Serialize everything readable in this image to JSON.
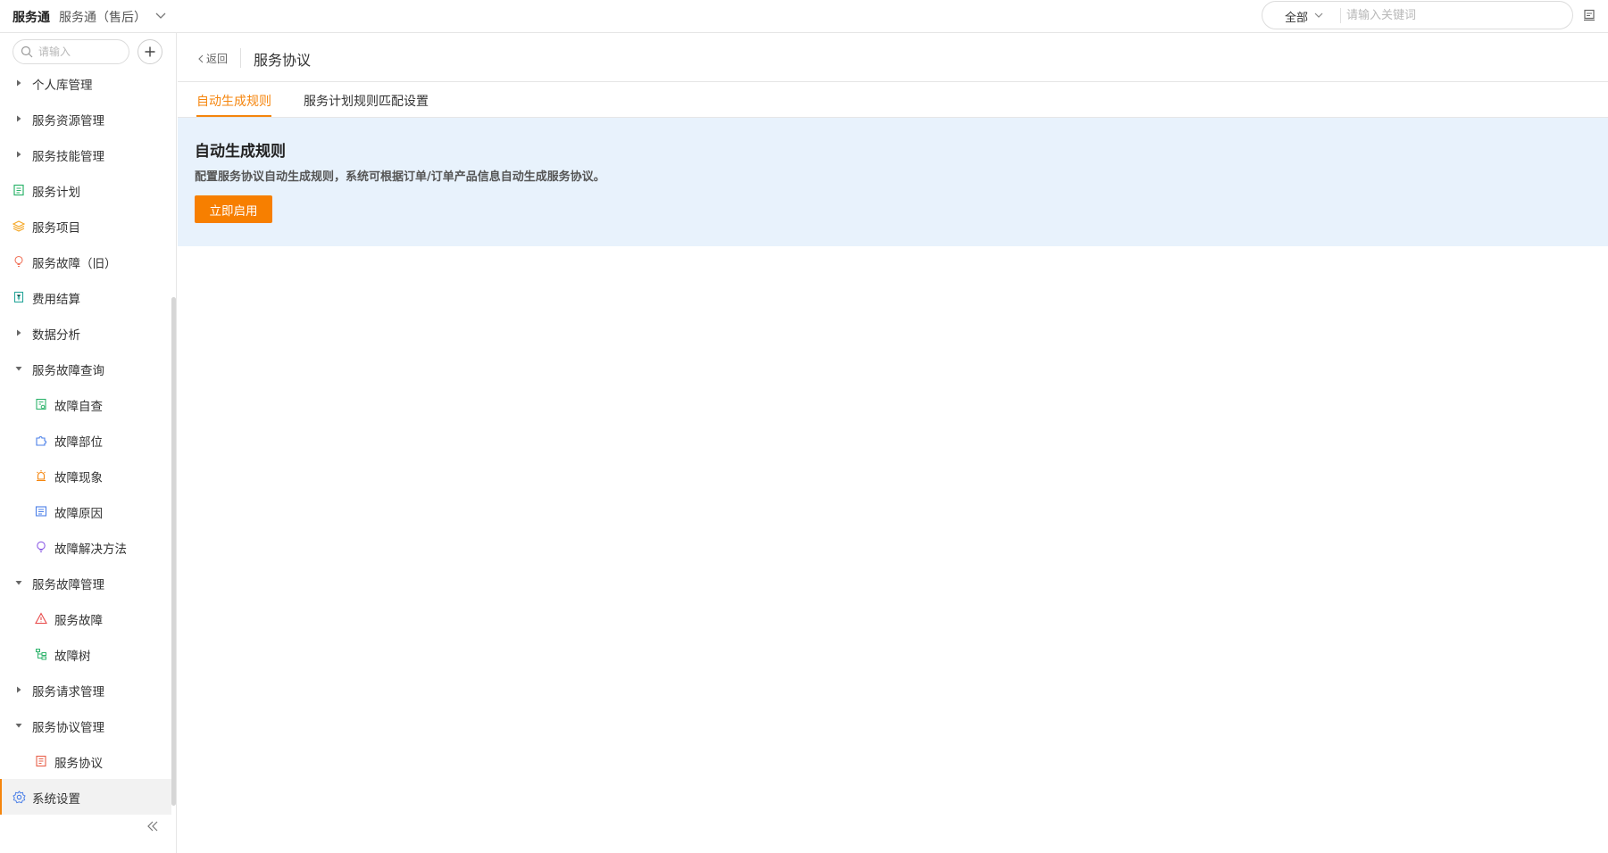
{
  "topbar": {
    "app_name": "服务通",
    "app_subtitle": "服务通（售后）",
    "search_scope": "全部",
    "search_placeholder": "请输入关键词"
  },
  "sidebar": {
    "search_placeholder": "请输入",
    "items": [
      {
        "label": "个人库管理",
        "icon": "caret-right-icon",
        "level": 0
      },
      {
        "label": "服务资源管理",
        "icon": "caret-right-icon",
        "level": 0
      },
      {
        "label": "服务技能管理",
        "icon": "caret-right-icon",
        "level": 0
      },
      {
        "label": "服务计划",
        "icon": "document-list-icon",
        "level": 0
      },
      {
        "label": "服务项目",
        "icon": "layers-icon",
        "level": 0
      },
      {
        "label": "服务故障（旧）",
        "icon": "lightbulb-icon",
        "level": 0
      },
      {
        "label": "费用结算",
        "icon": "receipt-icon",
        "level": 0
      },
      {
        "label": "数据分析",
        "icon": "caret-right-icon",
        "level": 0
      },
      {
        "label": "服务故障查询",
        "icon": "caret-down-icon",
        "level": 0
      },
      {
        "label": "故障自查",
        "icon": "checklist-icon",
        "level": 1
      },
      {
        "label": "故障部位",
        "icon": "puzzle-icon",
        "level": 1
      },
      {
        "label": "故障现象",
        "icon": "alarm-icon",
        "level": 1
      },
      {
        "label": "故障原因",
        "icon": "list-box-icon",
        "level": 1
      },
      {
        "label": "故障解决方法",
        "icon": "bulb-outline-icon",
        "level": 1
      },
      {
        "label": "服务故障管理",
        "icon": "caret-down-icon",
        "level": 0
      },
      {
        "label": "服务故障",
        "icon": "warning-icon",
        "level": 1
      },
      {
        "label": "故障树",
        "icon": "tree-icon",
        "level": 1
      },
      {
        "label": "服务请求管理",
        "icon": "caret-right-icon",
        "level": 0
      },
      {
        "label": "服务协议管理",
        "icon": "caret-down-icon",
        "level": 0
      },
      {
        "label": "服务协议",
        "icon": "contract-icon",
        "level": 1
      },
      {
        "label": "系统设置",
        "icon": "gear-icon",
        "level": 0,
        "active": true
      }
    ]
  },
  "main": {
    "back_label": "返回",
    "page_title": "服务协议",
    "tabs": [
      {
        "label": "自动生成规则",
        "active": true
      },
      {
        "label": "服务计划规则匹配设置",
        "active": false
      }
    ],
    "panel": {
      "title": "自动生成规则",
      "description": "配置服务协议自动生成规则，系统可根据订单/订单产品信息自动生成服务协议。",
      "button_label": "立即启用"
    }
  },
  "colors": {
    "accent": "#f5850d",
    "panel_bg": "#e8f2fc"
  }
}
